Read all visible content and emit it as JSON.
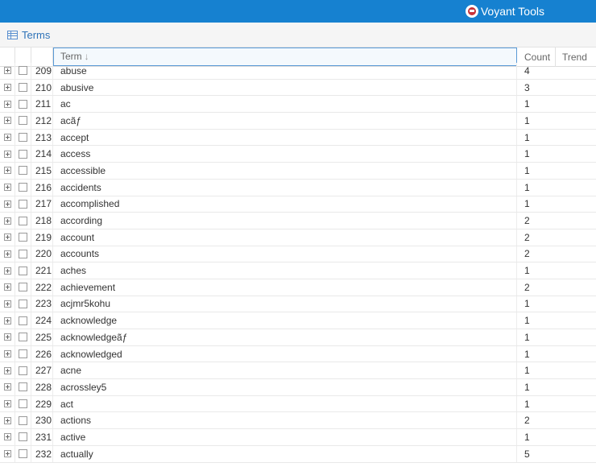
{
  "app": {
    "name": "Voyant Tools",
    "logo_icon": "voyant-logo-icon"
  },
  "panel": {
    "title": "Terms",
    "icon": "grid-icon"
  },
  "columns": {
    "term": "Term",
    "count": "Count",
    "trend": "Trend",
    "term_sort": "descending-arrow-icon"
  },
  "rows": [
    {
      "index": "209",
      "term": "abuse",
      "count": "4"
    },
    {
      "index": "210",
      "term": "abusive",
      "count": "3"
    },
    {
      "index": "211",
      "term": "ac",
      "count": "1"
    },
    {
      "index": "212",
      "term": "acãƒ",
      "count": "1"
    },
    {
      "index": "213",
      "term": "accept",
      "count": "1"
    },
    {
      "index": "214",
      "term": "access",
      "count": "1"
    },
    {
      "index": "215",
      "term": "accessible",
      "count": "1"
    },
    {
      "index": "216",
      "term": "accidents",
      "count": "1"
    },
    {
      "index": "217",
      "term": "accomplished",
      "count": "1"
    },
    {
      "index": "218",
      "term": "according",
      "count": "2"
    },
    {
      "index": "219",
      "term": "account",
      "count": "2"
    },
    {
      "index": "220",
      "term": "accounts",
      "count": "2"
    },
    {
      "index": "221",
      "term": "aches",
      "count": "1"
    },
    {
      "index": "222",
      "term": "achievement",
      "count": "2"
    },
    {
      "index": "223",
      "term": "acjmr5kohu",
      "count": "1"
    },
    {
      "index": "224",
      "term": "acknowledge",
      "count": "1"
    },
    {
      "index": "225",
      "term": "acknowledgeãƒ",
      "count": "1"
    },
    {
      "index": "226",
      "term": "acknowledged",
      "count": "1"
    },
    {
      "index": "227",
      "term": "acne",
      "count": "1"
    },
    {
      "index": "228",
      "term": "acrossley5",
      "count": "1"
    },
    {
      "index": "229",
      "term": "act",
      "count": "1"
    },
    {
      "index": "230",
      "term": "actions",
      "count": "2"
    },
    {
      "index": "231",
      "term": "active",
      "count": "1"
    },
    {
      "index": "232",
      "term": "actually",
      "count": "5"
    }
  ]
}
